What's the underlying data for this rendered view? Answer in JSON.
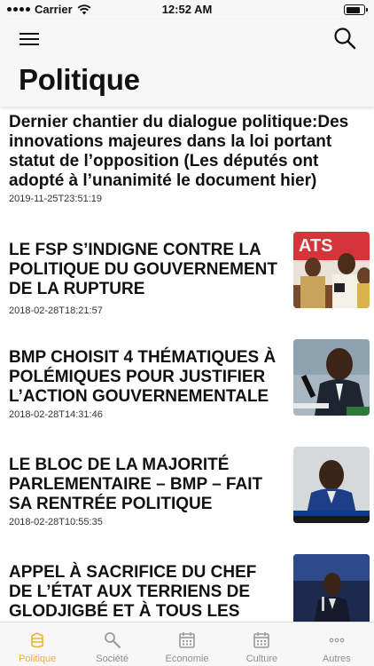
{
  "status_bar": {
    "carrier": "Carrier",
    "time": "12:52 AM",
    "battery_level": 0.85
  },
  "header": {
    "title": "Politique",
    "menu_icon": "hamburger-menu-icon",
    "search_icon": "search-icon"
  },
  "articles": [
    {
      "title": "Dernier chantier du dialogue politique:Des innovations majeures dans la loi portant statut de l’opposition (Les députés ont adopté à l’unanimité le document hier)",
      "date": "2019-11-25T23:51:19"
    },
    {
      "title": "LE FSP S’INDIGNE CONTRE LA POLITIQUE DU GOUVERNEMENT DE LA RUPTURE",
      "date": "2018-02-28T18:21:57",
      "thumbnail": "press-conference-photo"
    },
    {
      "title": "BMP CHOISIT 4 THÉMATIQUES À POLÉMIQUES POUR JUSTIFIER L’ACTION GOUVERNEMENTALE",
      "date": "2018-02-28T14:31:46",
      "thumbnail": "speaker-microphone-photo"
    },
    {
      "title": "LE BLOC DE LA MAJORITÉ PARLEMENTAIRE – BMP – FAIT SA RENTRÉE POLITIQUE",
      "date": "2018-02-28T10:55:35",
      "thumbnail": "tv-interview-photo"
    },
    {
      "title": "APPEL À SACRIFICE DU CHEF DE L’ÉTAT AUX TERRIENS DE GLODJIGBÉ ET À TOUS LES",
      "date": "",
      "thumbnail": "stage-speaker-photo"
    }
  ],
  "tabs": [
    {
      "label": "Politique",
      "icon": "politique-icon",
      "active": true
    },
    {
      "label": "Société",
      "icon": "societe-icon",
      "active": false
    },
    {
      "label": "Economie",
      "icon": "calendar-icon",
      "active": false
    },
    {
      "label": "Culture",
      "icon": "calendar-icon",
      "active": false
    },
    {
      "label": "Autres",
      "icon": "more-icon",
      "active": false
    }
  ],
  "colors": {
    "accent": "#f0b12a",
    "inactive": "#8e8e8e",
    "bar_bg": "#f7f7f7"
  }
}
